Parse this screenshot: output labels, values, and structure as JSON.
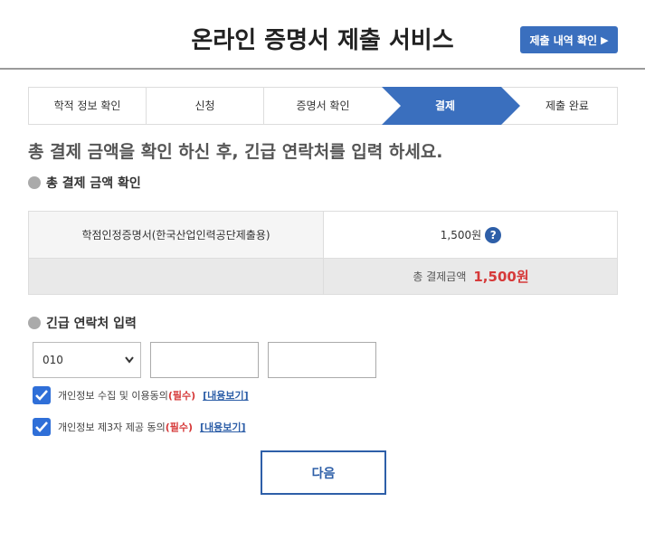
{
  "header": {
    "title": "온라인 증명서 제출 서비스",
    "history_button": "제출 내역 확인",
    "history_arrow": "▶"
  },
  "steps": [
    {
      "label": "학적 정보 확인",
      "active": false
    },
    {
      "label": "신청",
      "active": false
    },
    {
      "label": "증명서 확인",
      "active": false
    },
    {
      "label": "결제",
      "active": true
    },
    {
      "label": "제출 완료",
      "active": false
    }
  ],
  "instruction": "총 결제 금액을 확인 하신 후, 긴급 연락처를 입력 하세요.",
  "payment_section": {
    "label": "총 결제 금액 확인",
    "item_name": "학점인정증명서(한국산업인력공단제출용)",
    "item_price": "1,500원",
    "help_icon": "?",
    "total_label": "총 결제금액",
    "total_value": "1,500원"
  },
  "contact_section": {
    "label": "긴급 연락처 입력",
    "phone_prefix_selected": "010",
    "phone_middle_value": "",
    "phone_last_value": ""
  },
  "agreements": [
    {
      "text": "개인정보 수집 및 이용동의",
      "required": "(필수)",
      "link": "[내용보기]",
      "checked": true
    },
    {
      "text": "개인정보 제3자 제공 동의",
      "required": "(필수)",
      "link": "[내용보기]",
      "checked": true
    }
  ],
  "next_button": "다음",
  "colors": {
    "accent": "#3a6fbe",
    "active_step": "#3a6fbe",
    "required": "#d63a3a",
    "checkbox": "#2f6fd8"
  }
}
